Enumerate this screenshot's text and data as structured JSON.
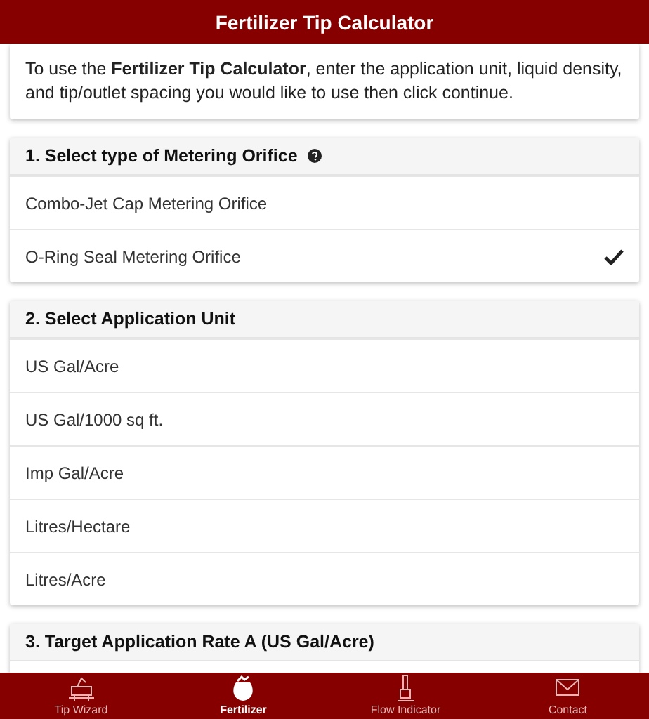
{
  "header": {
    "title": "Fertilizer Tip Calculator"
  },
  "intro": "To use the **Fertilizer Tip Calculator**, enter the application unit, liquid density, and tip/outlet spacing you would like to use then click continue.",
  "sections": [
    {
      "title": "1. Select type of Metering Orifice",
      "help": true,
      "options": [
        {
          "label": "Combo-Jet Cap Metering Orifice",
          "selected": false
        },
        {
          "label": "O-Ring Seal Metering Orifice",
          "selected": true
        }
      ]
    },
    {
      "title": "2. Select Application Unit",
      "help": false,
      "options": [
        {
          "label": "US Gal/Acre",
          "selected": false
        },
        {
          "label": "US Gal/1000 sq ft.",
          "selected": false
        },
        {
          "label": "Imp Gal/Acre",
          "selected": false
        },
        {
          "label": "Litres/Hectare",
          "selected": false
        },
        {
          "label": "Litres/Acre",
          "selected": false
        }
      ]
    },
    {
      "title": "3. Target Application Rate A (US Gal/Acre)",
      "help": false
    }
  ],
  "tabbar": [
    {
      "label": "Tip Wizard",
      "kind": "wizard",
      "selected": false
    },
    {
      "label": "Fertilizer",
      "kind": "fertilizer",
      "selected": true
    },
    {
      "label": "Flow Indicator",
      "kind": "flow",
      "selected": false
    },
    {
      "label": "Contact",
      "kind": "contact",
      "selected": false
    }
  ]
}
